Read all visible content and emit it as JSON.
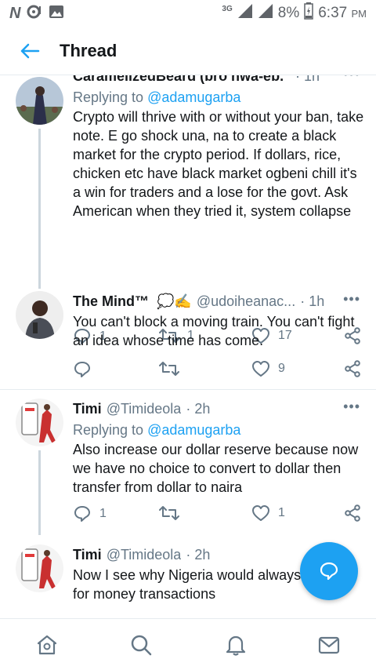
{
  "status_bar": {
    "network": "3G",
    "battery": "8%",
    "time": "6:37",
    "ampm": "PM",
    "carrier_icon": "N"
  },
  "header": {
    "title": "Thread"
  },
  "tweets": [
    {
      "name": "CaramelizedBeard (bro hwa-eb...",
      "handle": "",
      "time": "· 1h",
      "replying_prefix": "Replying to",
      "replying_to": "@adamugarba",
      "text": "Crypto will thrive with or without your ban, take note. E go shock una, na to create a black market for the crypto period. If dollars, rice, chicken etc have black market ogbeni chill it's a win for traders and a lose for the govt. Ask American when they tried it, system collapse",
      "replies": "1",
      "retweets": "1",
      "likes": "17"
    },
    {
      "name": "The Mind™",
      "emojis": "💭✍",
      "handle": "@udoiheanac...",
      "time": "· 1h",
      "text": "You can't block a moving train. You can't fight an idea whose time has come.",
      "replies": "",
      "retweets": "",
      "likes": "9"
    },
    {
      "name": "Timi",
      "handle": "@Timideola",
      "time": "· 2h",
      "replying_prefix": "Replying to",
      "replying_to": "@adamugarba",
      "text": "Also increase our dollar reserve because now we have no choice to convert to dollar then transfer from dollar to naira",
      "replies": "1",
      "retweets": "",
      "likes": "1"
    },
    {
      "name": "Timi",
      "handle": "@Timideola",
      "time": "· 2h",
      "text": "Now I see why Nigeria would always",
      "text_tail": "for money transactions"
    }
  ],
  "colors": {
    "accent": "#1da1f2",
    "muted": "#657786",
    "divider": "#e6ecf0"
  },
  "icons": {
    "nav": [
      "home-icon",
      "search-icon",
      "notifications-icon",
      "messages-icon"
    ],
    "fab": "compose-reply-icon"
  }
}
